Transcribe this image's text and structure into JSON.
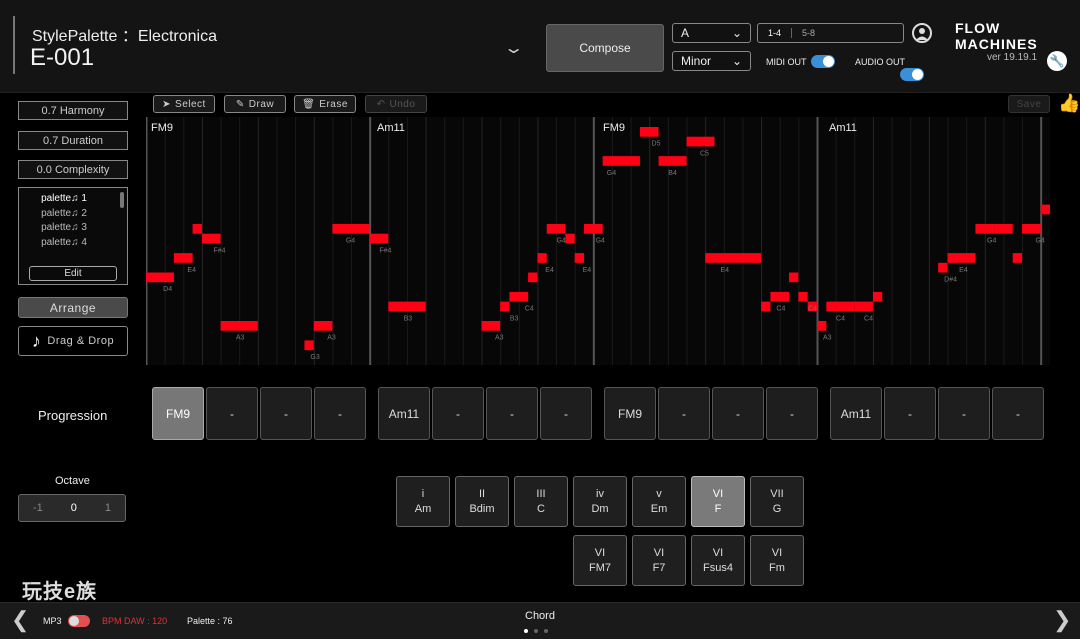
{
  "header": {
    "title": "StylePalette ：Electronica",
    "preset": "E-001",
    "compose_label": "Compose",
    "key_value": "A",
    "mode_value": "Minor",
    "bars": [
      "1-4",
      "5-8"
    ],
    "midi_out_label": "MIDI OUT",
    "audio_out_label": "AUDIO OUT",
    "logo": "FLOW MACHINES",
    "version": "ver 19.19.1"
  },
  "left_panel": {
    "harmony": "0.7 Harmony",
    "duration": "0.7 Duration",
    "complexity": "0.0 Complexity",
    "palettes": [
      "palette♫ 1",
      "palette♫ 2",
      "palette♫ 3",
      "palette♫ 4"
    ],
    "edit_label": "Edit",
    "arrange_label": "Arrange",
    "dragdrop_label": "Drag & Drop"
  },
  "tools": {
    "select": "Select",
    "draw": "Draw",
    "erase": "Erase",
    "undo": "Undo",
    "save": "Save"
  },
  "roll": {
    "chords": [
      "FM9",
      "Am11",
      "FM9",
      "Am11"
    ]
  },
  "notes": [
    {
      "start": 0.0,
      "dur": 1.5,
      "pitch": "D4"
    },
    {
      "start": 1.5,
      "dur": 1.0,
      "pitch": "E4"
    },
    {
      "start": 2.5,
      "dur": 0.5,
      "pitch": "G4"
    },
    {
      "start": 3.0,
      "dur": 1.0,
      "pitch": "F#4"
    },
    {
      "start": 4.0,
      "dur": 2.0,
      "pitch": "A3"
    },
    {
      "start": 8.5,
      "dur": 0.5,
      "pitch": "G3"
    },
    {
      "start": 9.0,
      "dur": 1.0,
      "pitch": "A3"
    },
    {
      "start": 10.0,
      "dur": 2.0,
      "pitch": "G4"
    },
    {
      "start": 12.0,
      "dur": 1.0,
      "pitch": "F#4"
    },
    {
      "start": 13.0,
      "dur": 2.0,
      "pitch": "B3"
    },
    {
      "start": 18.0,
      "dur": 1.0,
      "pitch": "A3"
    },
    {
      "start": 19.0,
      "dur": 0.5,
      "pitch": "B3"
    },
    {
      "start": 19.5,
      "dur": 1.0,
      "pitch": "C4"
    },
    {
      "start": 20.5,
      "dur": 0.5,
      "pitch": "D4"
    },
    {
      "start": 21.0,
      "dur": 0.5,
      "pitch": "E4"
    },
    {
      "start": 21.5,
      "dur": 1.0,
      "pitch": "G4"
    },
    {
      "start": 22.5,
      "dur": 0.5,
      "pitch": "F#4"
    },
    {
      "start": 23.0,
      "dur": 0.5,
      "pitch": "E4"
    },
    {
      "start": 23.5,
      "dur": 1.0,
      "pitch": "G4"
    },
    {
      "start": 24.5,
      "dur": 2.0,
      "pitch": "D5"
    },
    {
      "start": 26.5,
      "dur": 1.0,
      "pitch": "F5"
    },
    {
      "start": 27.5,
      "dur": 1.5,
      "pitch": "D5"
    },
    {
      "start": 29.0,
      "dur": 1.5,
      "pitch": "E5"
    },
    {
      "start": 30.0,
      "dur": 3.0,
      "pitch": "E4"
    },
    {
      "start": 33.0,
      "dur": 0.5,
      "pitch": "B3"
    },
    {
      "start": 33.5,
      "dur": 1.0,
      "pitch": "C4"
    },
    {
      "start": 34.5,
      "dur": 0.5,
      "pitch": "D4"
    },
    {
      "start": 35.0,
      "dur": 0.5,
      "pitch": "C4"
    },
    {
      "start": 35.5,
      "dur": 0.5,
      "pitch": "B3"
    },
    {
      "start": 36.0,
      "dur": 0.5,
      "pitch": "A3"
    },
    {
      "start": 36.5,
      "dur": 1.5,
      "pitch": "B3"
    },
    {
      "start": 38.0,
      "dur": 1.0,
      "pitch": "B3"
    },
    {
      "start": 39.0,
      "dur": 0.5,
      "pitch": "C4"
    },
    {
      "start": 42.5,
      "dur": 0.5,
      "pitch": "D#4"
    },
    {
      "start": 43.0,
      "dur": 1.5,
      "pitch": "E4"
    },
    {
      "start": 44.5,
      "dur": 1.0,
      "pitch": "G4"
    },
    {
      "start": 45.5,
      "dur": 1.0,
      "pitch": "G4"
    },
    {
      "start": 46.5,
      "dur": 0.5,
      "pitch": "E4"
    },
    {
      "start": 47.0,
      "dur": 1.0,
      "pitch": "G4"
    },
    {
      "start": 48.0,
      "dur": 0.5,
      "pitch": "A4"
    }
  ],
  "note_labels": [
    {
      "text": "D4",
      "beat": 0.6,
      "pitch": "D4"
    },
    {
      "text": "E4",
      "beat": 1.9,
      "pitch": "E4"
    },
    {
      "text": "F#4",
      "beat": 3.3,
      "pitch": "F#4"
    },
    {
      "text": "A3",
      "beat": 4.5,
      "pitch": "A3"
    },
    {
      "text": "G3",
      "beat": 8.5,
      "pitch": "G3"
    },
    {
      "text": "A3",
      "beat": 9.4,
      "pitch": "A3"
    },
    {
      "text": "G4",
      "beat": 10.4,
      "pitch": "G4"
    },
    {
      "text": "F#4",
      "beat": 12.2,
      "pitch": "F#4"
    },
    {
      "text": "B3",
      "beat": 13.5,
      "pitch": "B3"
    },
    {
      "text": "A3",
      "beat": 18.4,
      "pitch": "A3"
    },
    {
      "text": "B3",
      "beat": 19.2,
      "pitch": "B3"
    },
    {
      "text": "C4",
      "beat": 20.0,
      "pitch": "C4"
    },
    {
      "text": "E4",
      "beat": 21.1,
      "pitch": "E4"
    },
    {
      "text": "G4",
      "beat": 21.7,
      "pitch": "G4"
    },
    {
      "text": "E4",
      "beat": 23.1,
      "pitch": "E4"
    },
    {
      "text": "G4",
      "beat": 23.8,
      "pitch": "G4"
    },
    {
      "text": "G4",
      "beat": 24.4,
      "pitch": "D5"
    },
    {
      "text": "D5",
      "beat": 26.8,
      "pitch": "F5"
    },
    {
      "text": "B4",
      "beat": 27.7,
      "pitch": "D5"
    },
    {
      "text": "C5",
      "beat": 29.4,
      "pitch": "E5"
    },
    {
      "text": "E4",
      "beat": 30.5,
      "pitch": "E4"
    },
    {
      "text": "C4",
      "beat": 33.5,
      "pitch": "C4"
    },
    {
      "text": "C4",
      "beat": 35.2,
      "pitch": "C4"
    },
    {
      "text": "A3",
      "beat": 36.0,
      "pitch": "A3"
    },
    {
      "text": "C4",
      "beat": 36.7,
      "pitch": "B3"
    },
    {
      "text": "C4",
      "beat": 38.2,
      "pitch": "B3"
    },
    {
      "text": "D#4",
      "beat": 42.5,
      "pitch": "D#4"
    },
    {
      "text": "E4",
      "beat": 43.3,
      "pitch": "E4"
    },
    {
      "text": "G4",
      "beat": 44.8,
      "pitch": "G4"
    },
    {
      "text": "G4",
      "beat": 47.4,
      "pitch": "G4"
    }
  ],
  "progression": {
    "label": "Progression",
    "cells": [
      "FM9",
      "-",
      "-",
      "-",
      "Am11",
      "-",
      "-",
      "-",
      "FM9",
      "-",
      "-",
      "-",
      "Am11",
      "-",
      "-",
      "-"
    ]
  },
  "octave": {
    "label": "Octave",
    "values": [
      "-1",
      "0",
      "1"
    ]
  },
  "degrees_row1": [
    {
      "num": "i",
      "name": "Am"
    },
    {
      "num": "II",
      "name": "Bdim"
    },
    {
      "num": "III",
      "name": "C"
    },
    {
      "num": "iv",
      "name": "Dm"
    },
    {
      "num": "v",
      "name": "Em"
    },
    {
      "num": "VI",
      "name": "F"
    },
    {
      "num": "VII",
      "name": "G"
    }
  ],
  "degrees_row2": [
    {
      "num": "VI",
      "name": "FM7"
    },
    {
      "num": "VI",
      "name": "F7"
    },
    {
      "num": "VI",
      "name": "Fsus4"
    },
    {
      "num": "VI",
      "name": "Fm"
    }
  ],
  "bottom": {
    "mp3": "MP3",
    "bpm": "BPM  DAW : 120",
    "palette": "Palette : 76",
    "chord": "Chord"
  },
  "watermark": "玩技e族",
  "colors": {
    "note": "#ff0014",
    "accent": "#3a8fd6"
  }
}
